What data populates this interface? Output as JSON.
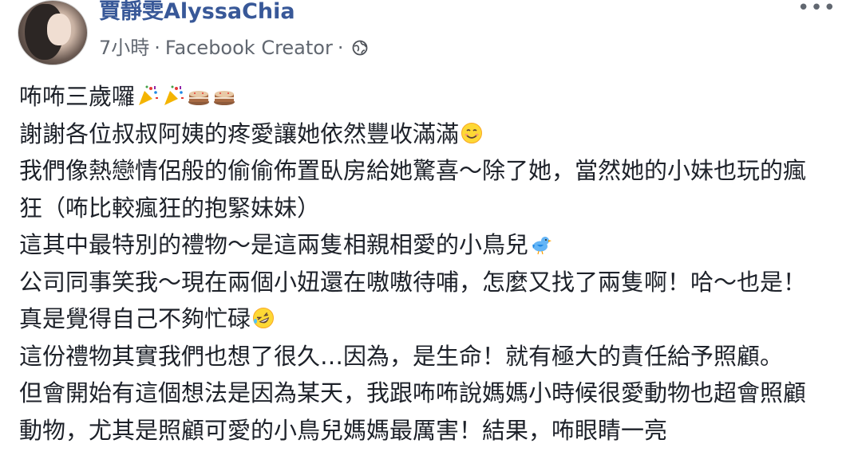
{
  "author": {
    "name": "賈靜雯AlyssaChia"
  },
  "meta": {
    "time": "7小時",
    "separator": "·",
    "source": "Facebook Creator",
    "separator2": "·"
  },
  "menu": {
    "more_label": "•••"
  },
  "icons": {
    "globe": "globe-icon",
    "party": "party-popper-emoji",
    "cake": "birthday-cake-emoji",
    "smile": "smiling-face-emoji",
    "bird": "bird-emoji",
    "laugh": "rolling-laughing-emoji"
  },
  "post": {
    "line1": "咘咘三歲囉",
    "line2": "謝謝各位叔叔阿姨的疼愛讓她依然豐收滿滿",
    "line3": "我們像熱戀情侶般的偷偷佈置臥房給她驚喜～除了她，當然她的小妹也玩的瘋狂（咘比較瘋狂的抱緊妹妹）",
    "line4": "這其中最特別的禮物～是這兩隻相親相愛的小鳥兒",
    "line5": "公司同事笑我～現在兩個小妞還在嗷嗷待哺，怎麼又找了兩隻啊！哈～也是！真是覺得自己不夠忙碌",
    "line6": "這份禮物其實我們也想了很久…因為，是生命！就有極大的責任給予照顧。",
    "line7": "但會開始有這個想法是因為某天，我跟咘咘說媽媽小時候很愛動物也超會照顧動物，尤其是照顧可愛的小鳥兒媽媽最厲害！結果，咘眼睛一亮"
  }
}
